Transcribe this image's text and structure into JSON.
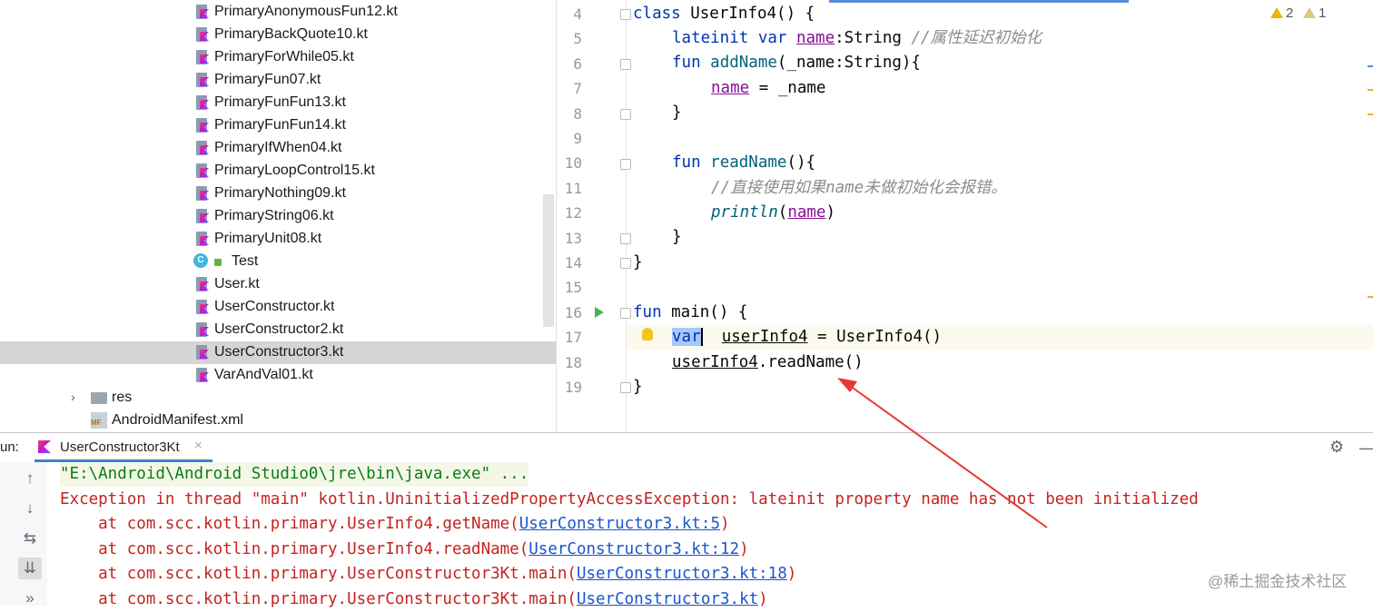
{
  "project_tree": {
    "files": [
      "PrimaryAnonymousFun12.kt",
      "PrimaryBackQuote10.kt",
      "PrimaryForWhile05.kt",
      "PrimaryFun07.kt",
      "PrimaryFunFun13.kt",
      "PrimaryFunFun14.kt",
      "PrimaryIfWhen04.kt",
      "PrimaryLoopControl15.kt",
      "PrimaryNothing09.kt",
      "PrimaryString06.kt",
      "PrimaryUnit08.kt"
    ],
    "class_item": "Test",
    "files_after": [
      "User.kt",
      "UserConstructor.kt",
      "UserConstructor2.kt",
      "UserConstructor3.kt",
      "VarAndVal01.kt"
    ],
    "selected_file": "UserConstructor3.kt",
    "folder": "res",
    "manifest": "AndroidManifest.xml",
    "manifest_icon_text": "MF"
  },
  "editor": {
    "line_numbers": [
      "4",
      "5",
      "6",
      "7",
      "8",
      "9",
      "10",
      "11",
      "12",
      "13",
      "14",
      "15",
      "16",
      "17",
      "18",
      "19"
    ],
    "warnings": {
      "errors_count": "2",
      "weak_count": "1"
    },
    "code": {
      "l4_kw": "class",
      "l4_rest": " UserInfo4() {",
      "l5_kw": "lateinit var",
      "l5_prop": "name",
      "l5_type": ":String ",
      "l5_cmt": "//属性延迟初始化",
      "l6_kw": "fun",
      "l6_fn": "addName",
      "l6_rest": "(_name:String){",
      "l7_prop": "name",
      "l7_rest": " = _name",
      "l8": "}",
      "l10_kw": "fun",
      "l10_fn": "readName",
      "l10_rest": "(){",
      "l11_cmt": "//直接使用如果name未做初始化会报错。",
      "l12_fn": "println",
      "l12_open": "(",
      "l12_prop": "name",
      "l12_close": ")",
      "l13": "}",
      "l14": "}",
      "l16_kw": "fun",
      "l16_rest": " main() {",
      "l17_var": "var",
      "l17_name": "userInfo4",
      "l17_rest": " = UserInfo4()",
      "l18_name": "userInfo4",
      "l18_rest": ".readName()",
      "l19": "}"
    }
  },
  "run_panel": {
    "label": "un:",
    "tab_title": "UserConstructor3Kt",
    "tab_close": "×",
    "console": {
      "cmd": "\"E:\\Android\\Android Studio0\\jre\\bin\\java.exe\" ...",
      "exception": "Exception in thread \"main\" kotlin.UninitializedPropertyAccessException: lateinit property name has not been initialized",
      "trace": [
        {
          "prefix": "    at com.scc.kotlin.primary.UserInfo4.getName(",
          "link": "UserConstructor3.kt:5",
          "suffix": ")"
        },
        {
          "prefix": "    at com.scc.kotlin.primary.UserInfo4.readName(",
          "link": "UserConstructor3.kt:12",
          "suffix": ")"
        },
        {
          "prefix": "    at com.scc.kotlin.primary.UserConstructor3Kt.main(",
          "link": "UserConstructor3.kt:18",
          "suffix": ")"
        },
        {
          "prefix": "    at com.scc.kotlin.primary.UserConstructor3Kt.main(",
          "link": "UserConstructor3.kt",
          "suffix": ")"
        }
      ]
    },
    "tools": [
      "↑",
      "↓",
      "⇆",
      "⇊",
      "»"
    ]
  },
  "watermark": "@稀土掘金技术社区",
  "colors": {
    "keyword": "#0033b3",
    "property": "#871094",
    "error": "#c4231f",
    "link": "#1a55cf",
    "annotation_arrow": "#e53935"
  }
}
